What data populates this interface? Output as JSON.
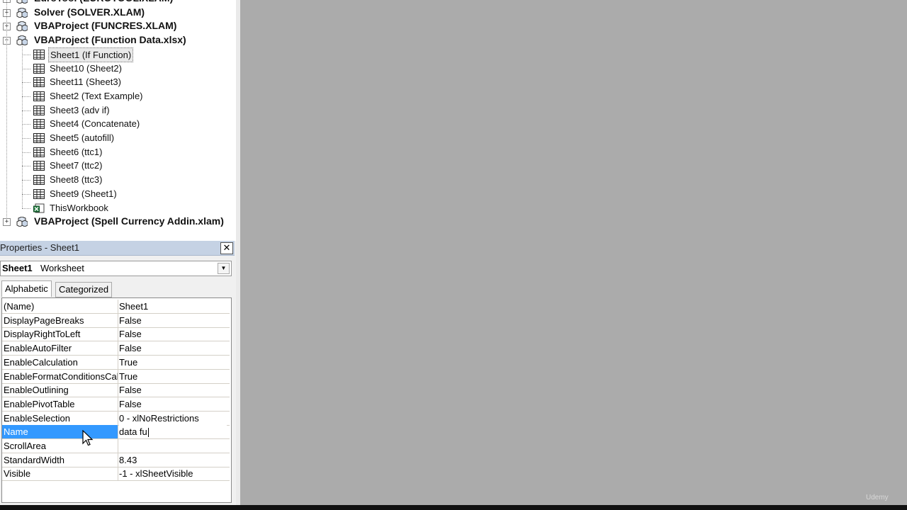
{
  "project_tree": {
    "projects_top": [
      {
        "label": "EuroTool (EUROTOOL.XLAM)",
        "expander": "+"
      },
      {
        "label": "Solver (SOLVER.XLAM)",
        "expander": "+"
      },
      {
        "label": "VBAProject (FUNCRES.XLAM)",
        "expander": "+"
      },
      {
        "label": "VBAProject (Function Data.xlsx)",
        "expander": "−"
      }
    ],
    "children": [
      {
        "label": "Sheet1 (If Function)",
        "icon": "worksheet-icon"
      },
      {
        "label": "Sheet10 (Sheet2)",
        "icon": "worksheet-icon"
      },
      {
        "label": "Sheet11 (Sheet3)",
        "icon": "worksheet-icon"
      },
      {
        "label": "Sheet2 (Text Example)",
        "icon": "worksheet-icon"
      },
      {
        "label": "Sheet3 (adv if)",
        "icon": "worksheet-icon"
      },
      {
        "label": "Sheet4 (Concatenate)",
        "icon": "worksheet-icon"
      },
      {
        "label": "Sheet5 (autofill)",
        "icon": "worksheet-icon"
      },
      {
        "label": "Sheet6 (ttc1)",
        "icon": "worksheet-icon"
      },
      {
        "label": "Sheet7 (ttc2)",
        "icon": "worksheet-icon"
      },
      {
        "label": "Sheet8 (ttc3)",
        "icon": "worksheet-icon"
      },
      {
        "label": "Sheet9 (Sheet1)",
        "icon": "worksheet-icon"
      },
      {
        "label": "ThisWorkbook",
        "icon": "workbook-icon"
      }
    ],
    "projects_bottom": [
      {
        "label": "VBAProject (Spell Currency Addin.xlam)",
        "expander": "+"
      }
    ]
  },
  "properties": {
    "title": "Properties - Sheet1",
    "close_glyph": "✕",
    "object_name": "Sheet1",
    "object_type": "Worksheet",
    "dropdown_glyph": "▼",
    "tabs": [
      "Alphabetic",
      "Categorized"
    ],
    "rows": [
      {
        "name": "(Name)",
        "value": "Sheet1"
      },
      {
        "name": "DisplayPageBreaks",
        "value": "False"
      },
      {
        "name": "DisplayRightToLeft",
        "value": "False"
      },
      {
        "name": "EnableAutoFilter",
        "value": "False"
      },
      {
        "name": "EnableCalculation",
        "value": "True"
      },
      {
        "name": "EnableFormatConditionsCal",
        "value": "True"
      },
      {
        "name": "EnableOutlining",
        "value": "False"
      },
      {
        "name": "EnablePivotTable",
        "value": "False"
      },
      {
        "name": "EnableSelection",
        "value": "0 - xlNoRestrictions"
      },
      {
        "name": "Name",
        "value": "data fu"
      },
      {
        "name": "ScrollArea",
        "value": ""
      },
      {
        "name": "StandardWidth",
        "value": "8.43"
      },
      {
        "name": "Visible",
        "value": "-1 - xlSheetVisible"
      }
    ],
    "active_row": "Name"
  },
  "watermark": "Udemy",
  "colors": {
    "workspace_gray": "#ababab",
    "title_bar": "#c5d2e4",
    "selection_blue": "#3399ff"
  }
}
